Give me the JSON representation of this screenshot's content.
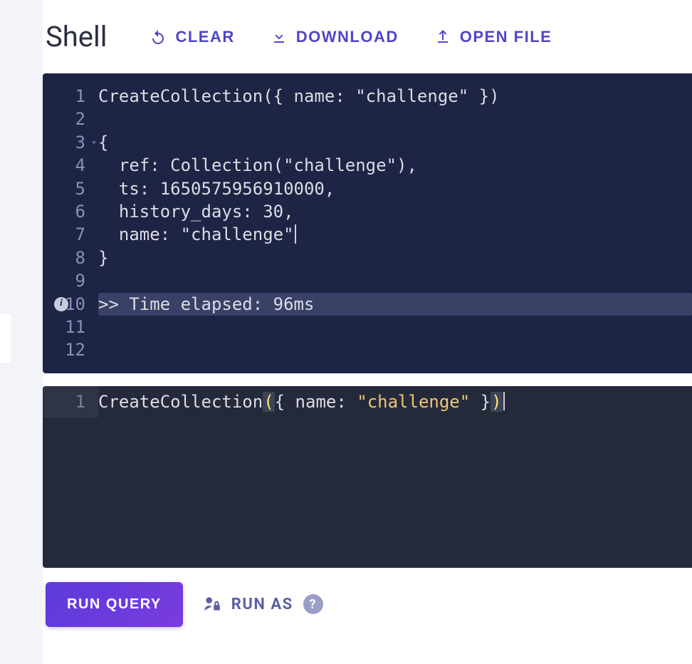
{
  "header": {
    "title": "Shell",
    "clear_label": "CLEAR",
    "download_label": "DOWNLOAD",
    "openfile_label": "OPEN FILE"
  },
  "output": {
    "lines": [
      {
        "n": "1",
        "text": "CreateCollection({ name: \"challenge\" })"
      },
      {
        "n": "2",
        "text": ""
      },
      {
        "n": "3",
        "text": "{",
        "fold": true
      },
      {
        "n": "4",
        "text": "  ref: Collection(\"challenge\"),"
      },
      {
        "n": "5",
        "text": "  ts: 1650575956910000,"
      },
      {
        "n": "6",
        "text": "  history_days: 30,"
      },
      {
        "n": "7",
        "text": "  name: \"challenge\"",
        "cursor": true
      },
      {
        "n": "8",
        "text": "}"
      },
      {
        "n": "9",
        "text": ""
      },
      {
        "n": "10",
        "text": ">> Time elapsed: 96ms",
        "info": true,
        "highlight": true
      },
      {
        "n": "11",
        "text": ""
      },
      {
        "n": "12",
        "text": ""
      }
    ]
  },
  "input": {
    "line_number": "1",
    "tokens": {
      "fn": "CreateCollection",
      "open_paren": "(",
      "open_brace": "{",
      "prop": " name: ",
      "string": "\"challenge\"",
      "close_brace": " }",
      "close_paren": ")"
    }
  },
  "actions": {
    "run_label": "RUN QUERY",
    "runas_label": "RUN AS",
    "help_label": "?"
  }
}
